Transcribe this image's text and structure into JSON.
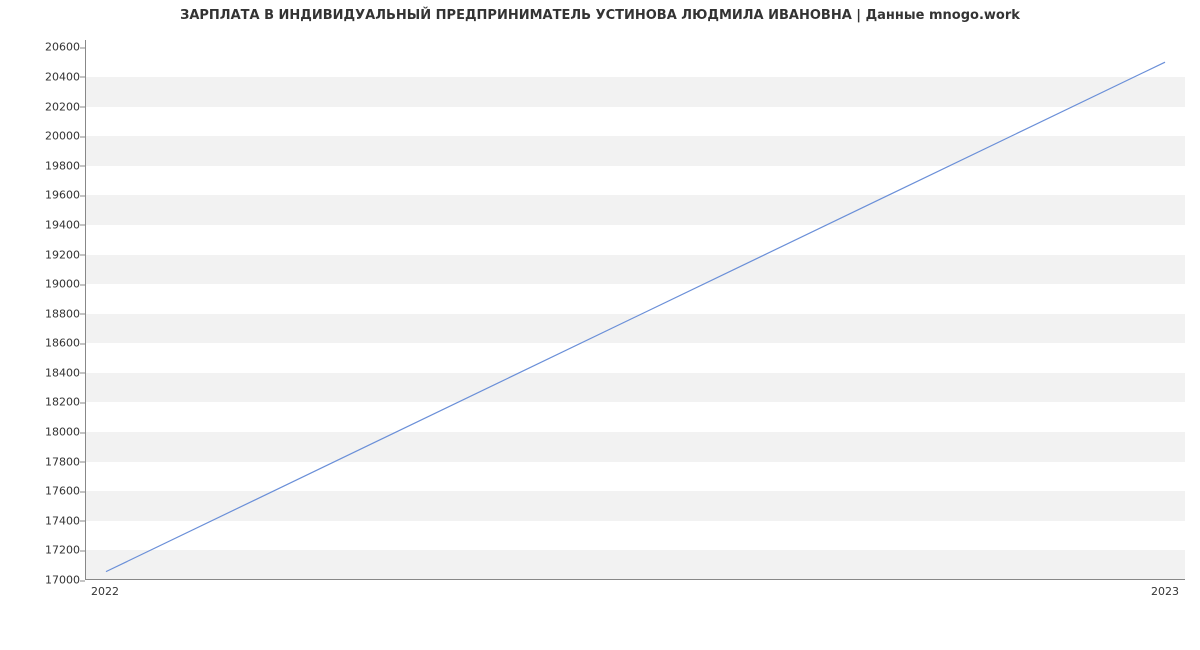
{
  "chart_data": {
    "type": "line",
    "title": "ЗАРПЛАТА В ИНДИВИДУАЛЬНЫЙ ПРЕДПРИНИМАТЕЛЬ УСТИНОВА ЛЮДМИЛА ИВАНОВНА | Данные mnogo.work",
    "x": [
      2022,
      2023
    ],
    "values": [
      17050,
      20500
    ],
    "xticks": [
      "2022",
      "2023"
    ],
    "yticks": [
      17000,
      17200,
      17400,
      17600,
      17800,
      18000,
      18200,
      18400,
      18600,
      18800,
      19000,
      19200,
      19400,
      19600,
      19800,
      20000,
      20200,
      20400,
      20600
    ],
    "ylim": [
      17000,
      20650
    ],
    "xlabel": "",
    "ylabel": "",
    "line_color": "#6a8fd8",
    "band_color": "#f2f2f2"
  }
}
